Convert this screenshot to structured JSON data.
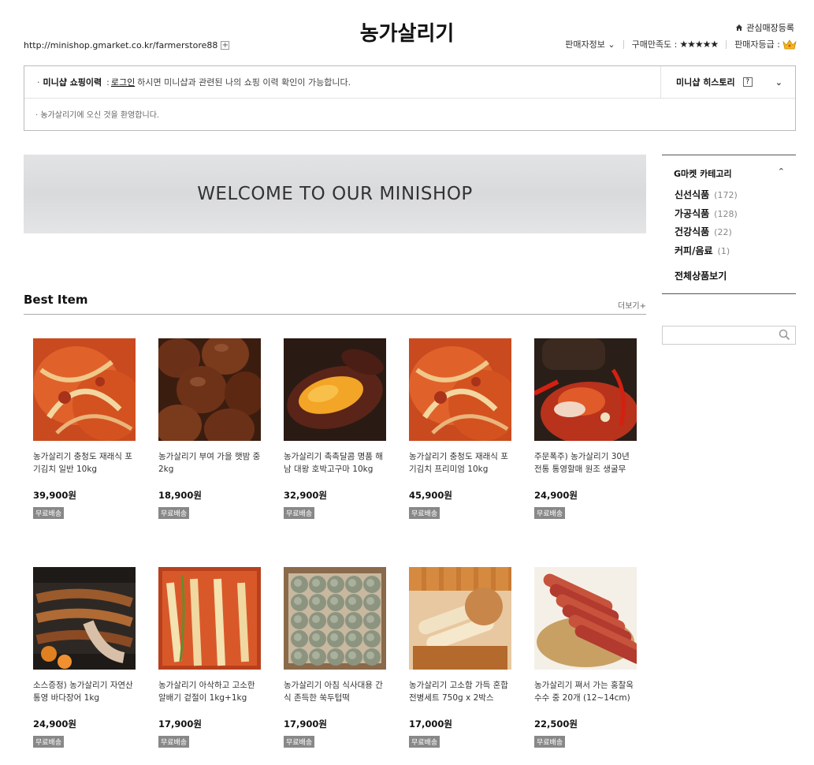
{
  "header": {
    "shop_url": "http://minishop.gmarket.co.kr/farmerstore88",
    "plus": "+",
    "title": "농가살리기",
    "fav_label": "관심매장등록",
    "seller_info": "판매자정보",
    "satisfaction_label": "구매만족도 :",
    "satisfaction_stars": "★★★★★",
    "grade_label": "판매자등급 :"
  },
  "history": {
    "label": "미니샵 쇼핑이력",
    "colon": ":",
    "login": "로그인",
    "message": "하시면 미니샵과 관련된 나의 쇼핑 이력 확인이 가능합니다.",
    "history_title": "미니샵 히스토리",
    "help": "?",
    "welcome": "농가살리기에 오신 것을 환영합니다."
  },
  "banner": {
    "text": "WELCOME TO OUR MINISHOP"
  },
  "best": {
    "title": "Best Item",
    "more": "더보기+",
    "items": [
      {
        "name": "농가살리기 충청도 재래식 포기김치 일반 10kg",
        "price": "39,900원",
        "badge": "무료배송",
        "img": "kimchi"
      },
      {
        "name": "농가살리기 부여 가을 햇밤 중 2kg",
        "price": "18,900원",
        "badge": "무료배송",
        "img": "chestnut"
      },
      {
        "name": "농가살리기 촉촉달콤 명품 해남 대왕 호박고구마 10kg",
        "price": "32,900원",
        "badge": "무료배송",
        "img": "potato"
      },
      {
        "name": "농가살리기 충청도 재래식 포기김치 프리미엄 10kg",
        "price": "45,900원",
        "badge": "무료배송",
        "img": "kimchi"
      },
      {
        "name": "주문폭주) 농가살리기 30년 전통 통영할매 원조 생굴무",
        "price": "24,900원",
        "badge": "무료배송",
        "img": "oyster"
      },
      {
        "name": "소스증정) 농가살리기 자연산 통영 바다장어 1kg",
        "price": "24,900원",
        "badge": "무료배송",
        "img": "eel"
      },
      {
        "name": "농가살리기 아삭하고 고소한 알배기 겉절이 1kg+1kg",
        "price": "17,900원",
        "badge": "무료배송",
        "img": "kimchi2"
      },
      {
        "name": "농가살리기 아침 식사대용 간식 존득한 쑥두텁떡",
        "price": "17,900원",
        "badge": "무료배송",
        "img": "ricecake"
      },
      {
        "name": "농가살리기 고소함 가득 혼합전병세트 750g x 2박스",
        "price": "17,000원",
        "badge": "무료배송",
        "img": "cracker"
      },
      {
        "name": "농가살리기 쪄서 가는 홍찰옥수수 중 20개 (12~14cm)",
        "price": "22,500원",
        "badge": "무료배송",
        "img": "corn"
      }
    ]
  },
  "sidebar": {
    "category_title": "G마켓 카테고리",
    "categories": [
      {
        "label": "신선식품",
        "count": "(172)"
      },
      {
        "label": "가공식품",
        "count": "(128)"
      },
      {
        "label": "건강식품",
        "count": "(22)"
      },
      {
        "label": "커피/음료",
        "count": "(1)"
      }
    ],
    "all_label": "전체상품보기",
    "search_placeholder": ""
  },
  "colors": {
    "badge": "#888888",
    "border": "#bbbbbb",
    "crown": "#f3b71b"
  }
}
